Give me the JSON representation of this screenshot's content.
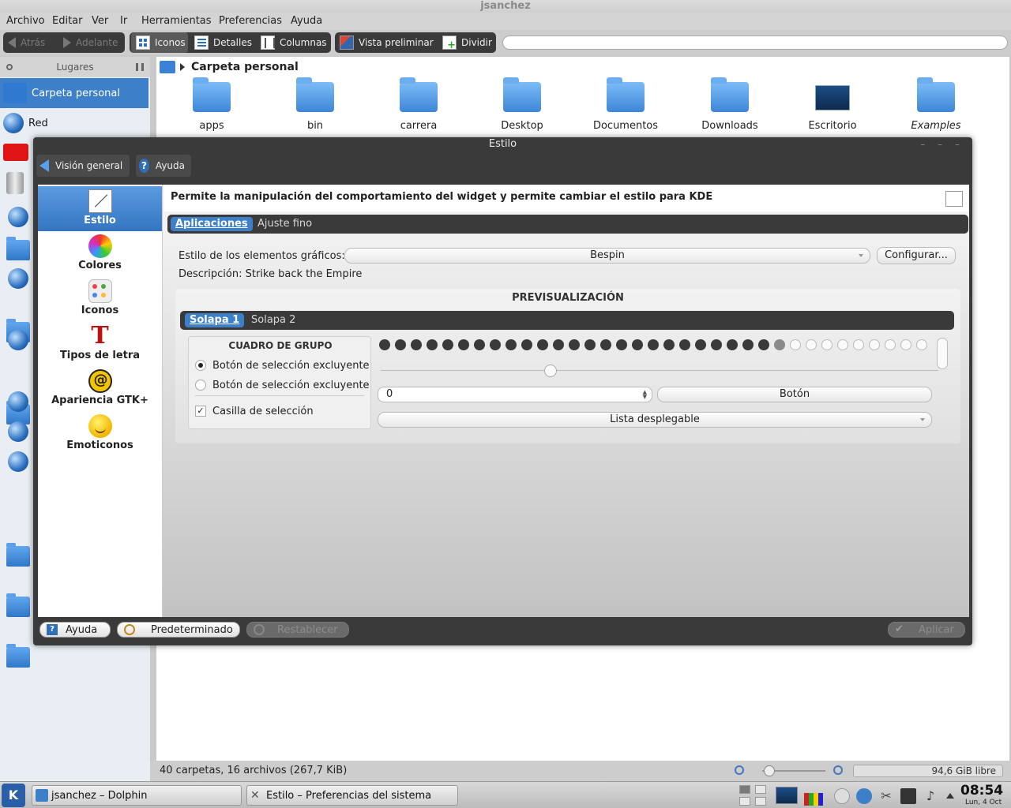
{
  "dolphin": {
    "title": "jsanchez",
    "menu": [
      "Archivo",
      "Editar",
      "Ver",
      "Ir",
      "Herramientas",
      "Preferencias",
      "Ayuda"
    ],
    "toolbar": {
      "back": "Atrás",
      "forward": "Adelante",
      "icons": "Iconos",
      "details": "Detalles",
      "columns": "Columnas",
      "preview": "Vista preliminar",
      "split": "Dividir"
    },
    "places": {
      "header": "Lugares",
      "items": [
        {
          "label": "Carpeta personal"
        },
        {
          "label": "Red"
        }
      ]
    },
    "breadcrumb": "Carpeta personal",
    "files": [
      {
        "name": "apps",
        "type": "folder"
      },
      {
        "name": "bin",
        "type": "folder"
      },
      {
        "name": "carrera",
        "type": "folder"
      },
      {
        "name": "Desktop",
        "type": "folder"
      },
      {
        "name": "Documentos",
        "type": "folder"
      },
      {
        "name": "Downloads",
        "type": "folder"
      },
      {
        "name": "Escritorio",
        "type": "desktop"
      },
      {
        "name": "Examples",
        "type": "folder-link"
      }
    ],
    "status": "40 carpetas, 16 archivos (267,7 KiB)",
    "free_space": "94,6 GiB libre"
  },
  "estilo": {
    "title": "Estilo",
    "nav_back": "Visión general",
    "nav_help": "Ayuda",
    "categories": [
      {
        "label": "Estilo",
        "icon": "style-icon"
      },
      {
        "label": "Colores",
        "icon": "colors-icon"
      },
      {
        "label": "Iconos",
        "icon": "icons-icon"
      },
      {
        "label": "Tipos de letra",
        "icon": "fonts-icon"
      },
      {
        "label": "Apariencia GTK+",
        "icon": "gtk-icon"
      },
      {
        "label": "Emoticonos",
        "icon": "emoticons-icon"
      }
    ],
    "description_header": "Permite la manipulación del comportamiento del widget y permite cambiar el estilo para KDE",
    "tabs": [
      "Aplicaciones",
      "Ajuste fino"
    ],
    "widget_style_label": "Estilo de los elementos gráficos:",
    "widget_style_value": "Bespin",
    "configure_button": "Configurar...",
    "description_line": "Descripción: Strike back the Empire",
    "preview": {
      "title": "PREVISUALIZACIÓN",
      "tabs": [
        "Solapa 1",
        "Solapa 2"
      ],
      "group_title": "CUADRO DE GRUPO",
      "radio1": "Botón de selección excluyente",
      "radio2": "Botón de selección excluyente",
      "checkbox": "Casilla de selección",
      "progress_fraction": 0.72,
      "slider_fraction": 0.3,
      "spin_value": "0",
      "button": "Botón",
      "dropdown": "Lista desplegable"
    },
    "bottom": {
      "help": "Ayuda",
      "default": "Predeterminado",
      "reset": "Restablecer",
      "apply": "Aplicar"
    }
  },
  "taskbar": {
    "tasks": [
      "jsanchez – Dolphin",
      "Estilo – Preferencias del sistema"
    ],
    "time": "08:54",
    "date": "Lun, 4 Oct"
  },
  "colors": {
    "accent": "#3d7fc9",
    "dark_bar": "#3a3a3a"
  }
}
